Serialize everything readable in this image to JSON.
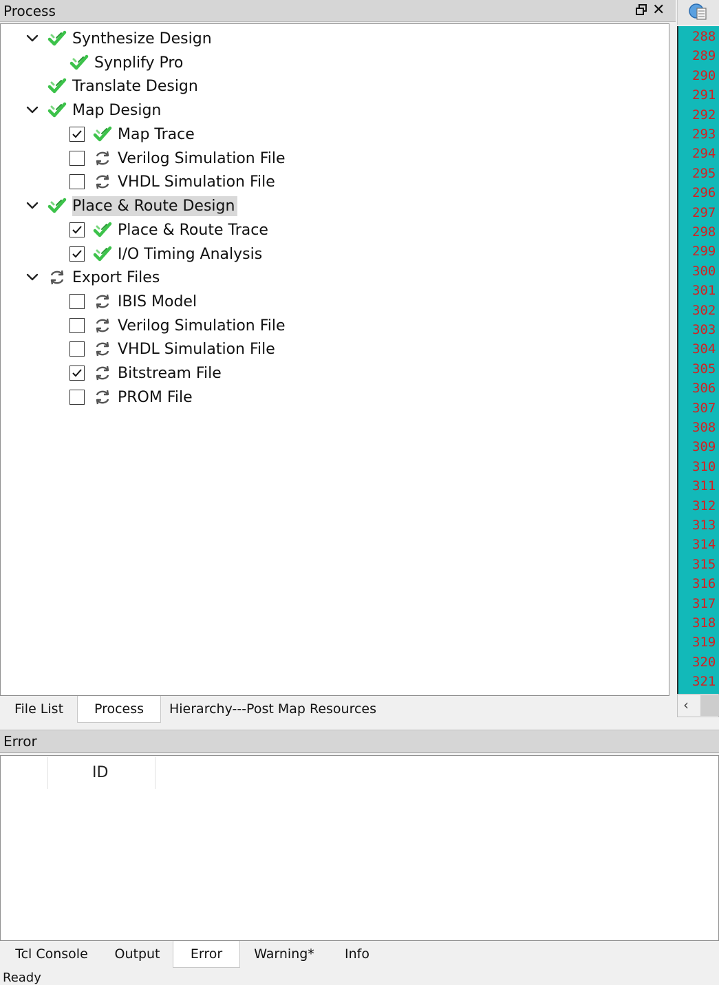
{
  "process_panel": {
    "title": "Process",
    "tree": [
      {
        "label": "Synthesize Design",
        "expandable": true,
        "status": "ok"
      },
      {
        "label": "Synplify Pro",
        "status": "ok"
      },
      {
        "label": "Translate Design",
        "status": "ok"
      },
      {
        "label": "Map Design",
        "expandable": true,
        "status": "ok"
      },
      {
        "label": "Map Trace",
        "checked": true,
        "status": "ok"
      },
      {
        "label": "Verilog Simulation File",
        "checked": false,
        "status": "pending"
      },
      {
        "label": "VHDL Simulation File",
        "checked": false,
        "status": "pending"
      },
      {
        "label": "Place & Route Design",
        "expandable": true,
        "status": "ok",
        "selected": true
      },
      {
        "label": "Place & Route Trace",
        "checked": true,
        "status": "ok"
      },
      {
        "label": "I/O Timing Analysis",
        "checked": true,
        "status": "ok"
      },
      {
        "label": "Export Files",
        "expandable": true,
        "status": "pending"
      },
      {
        "label": "IBIS Model",
        "checked": false,
        "status": "pending"
      },
      {
        "label": "Verilog Simulation File",
        "checked": false,
        "status": "pending"
      },
      {
        "label": "VHDL Simulation File",
        "checked": false,
        "status": "pending"
      },
      {
        "label": "Bitstream File",
        "checked": true,
        "status": "pending"
      },
      {
        "label": "PROM File",
        "checked": false,
        "status": "pending"
      }
    ],
    "tabs": [
      {
        "label": "File List"
      },
      {
        "label": "Process",
        "active": true
      },
      {
        "label": "Hierarchy---Post Map Resources"
      }
    ]
  },
  "editor": {
    "line_numbers": [
      "288",
      "289",
      "290",
      "291",
      "292",
      "293",
      "294",
      "295",
      "296",
      "297",
      "298",
      "299",
      "300",
      "301",
      "302",
      "303",
      "304",
      "305",
      "306",
      "307",
      "308",
      "309",
      "310",
      "311",
      "312",
      "313",
      "314",
      "315",
      "316",
      "317",
      "318",
      "319",
      "320",
      "321"
    ],
    "line_number_color": "#d42020",
    "gutter_color": "#12b9b9"
  },
  "error_panel": {
    "title": "Error",
    "column_header": "ID"
  },
  "bottom_tabs": [
    {
      "label": "Tcl Console"
    },
    {
      "label": "Output"
    },
    {
      "label": "Error",
      "active": true
    },
    {
      "label": "Warning*"
    },
    {
      "label": "Info"
    }
  ],
  "status_bar": {
    "text": "Ready"
  },
  "colors": {
    "ok_check": "#3cc24a",
    "pending_icon": "#555555",
    "selection": "#d9d9d9"
  }
}
